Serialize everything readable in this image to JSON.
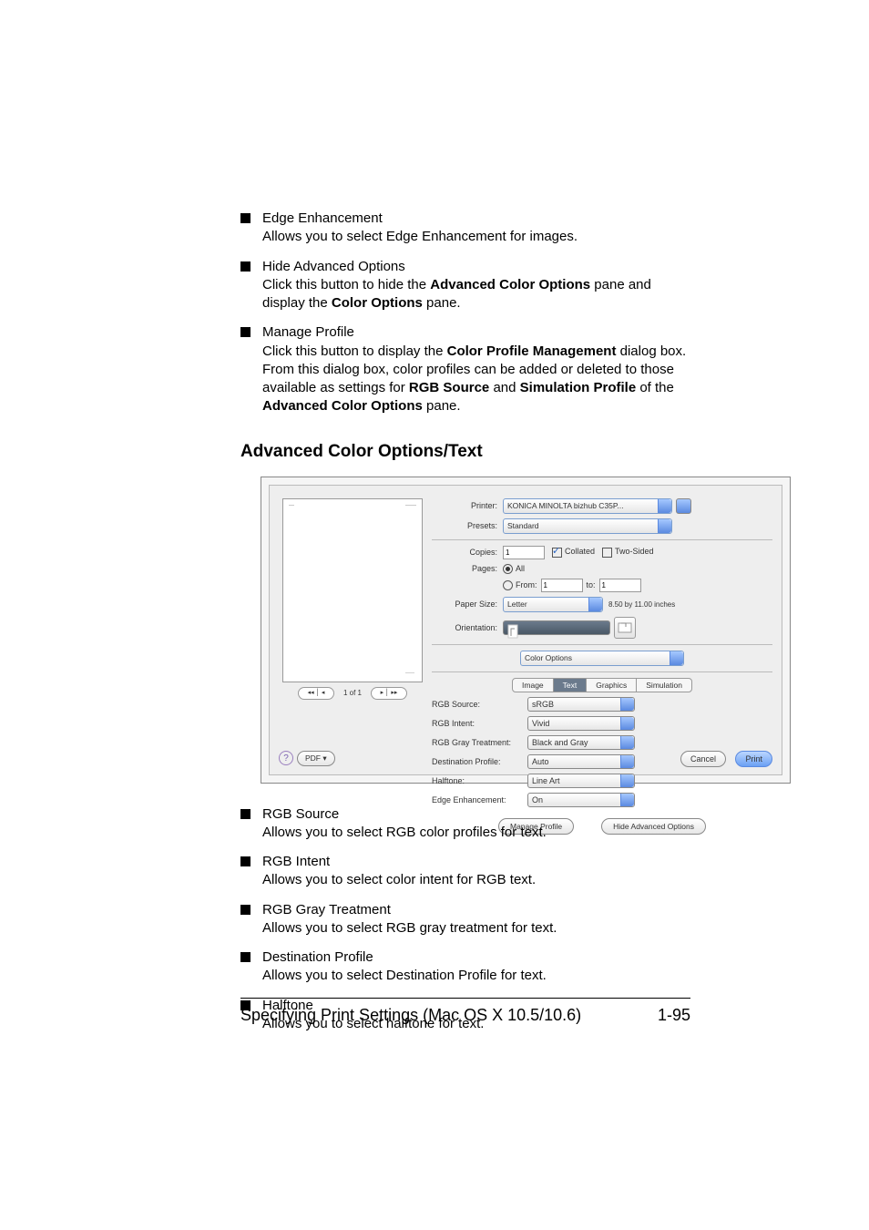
{
  "top_bullets": [
    {
      "title": "Edge Enhancement",
      "desc": "Allows you to select Edge Enhancement for images."
    },
    {
      "title": "Hide Advanced Options",
      "desc_parts": [
        "Click this button to hide the ",
        {
          "b": "Advanced Color Options"
        },
        " pane and display the ",
        {
          "b": "Color Options"
        },
        " pane."
      ]
    },
    {
      "title": "Manage Profile",
      "desc_parts": [
        "Click this button to display the ",
        {
          "b": "Color Profile Management"
        },
        " dialog box. From this dialog box, color profiles can be added or deleted to those available as settings for ",
        {
          "b": "RGB Source"
        },
        " and ",
        {
          "b": "Simulation Profile"
        },
        " of the ",
        {
          "b": "Advanced Color Options"
        },
        " pane."
      ]
    }
  ],
  "section_heading": "Advanced Color Options/Text",
  "dialog": {
    "nav_page": "1 of 1",
    "printer_label": "Printer:",
    "printer_value": "KONICA MINOLTA bizhub C35P...",
    "presets_label": "Presets:",
    "presets_value": "Standard",
    "copies_label": "Copies:",
    "copies_value": "1",
    "collated_label": "Collated",
    "two_sided_label": "Two-Sided",
    "pages_label": "Pages:",
    "pages_all": "All",
    "from_label": "From:",
    "from_value": "1",
    "to_label": "to:",
    "to_value": "1",
    "paper_size_label": "Paper Size:",
    "paper_size_value": "Letter",
    "paper_dim": "8.50 by 11.00 inches",
    "orientation_label": "Orientation:",
    "pane_name": "Color Options",
    "tabs": [
      "Image",
      "Text",
      "Graphics",
      "Simulation"
    ],
    "active_tab": "Text",
    "options": [
      {
        "label": "RGB Source:",
        "value": "sRGB"
      },
      {
        "label": "RGB Intent:",
        "value": "Vivid"
      },
      {
        "label": "RGB Gray Treatment:",
        "value": "Black and Gray"
      },
      {
        "label": "Destination Profile:",
        "value": "Auto"
      },
      {
        "label": "Halftone:",
        "value": "Line Art"
      },
      {
        "label": "Edge Enhancement:",
        "value": "On"
      }
    ],
    "manage_btn": "Manage Profile",
    "hide_btn": "Hide Advanced Options",
    "pdf_btn": "PDF ▾",
    "cancel_btn": "Cancel",
    "print_btn": "Print"
  },
  "bottom_bullets": [
    {
      "title": "RGB Source",
      "desc": "Allows you to select RGB color profiles for text."
    },
    {
      "title": "RGB Intent",
      "desc": "Allows you to select color intent for RGB text."
    },
    {
      "title": "RGB Gray Treatment",
      "desc": "Allows you to select RGB gray treatment for text."
    },
    {
      "title": "Destination Profile",
      "desc": "Allows you to select Destination Profile for text."
    },
    {
      "title": "Halftone",
      "desc": "Allows you to select halftone for text."
    }
  ],
  "footer": {
    "left": "Specifying Print Settings (Mac OS X 10.5/10.6)",
    "right": "1-95"
  }
}
